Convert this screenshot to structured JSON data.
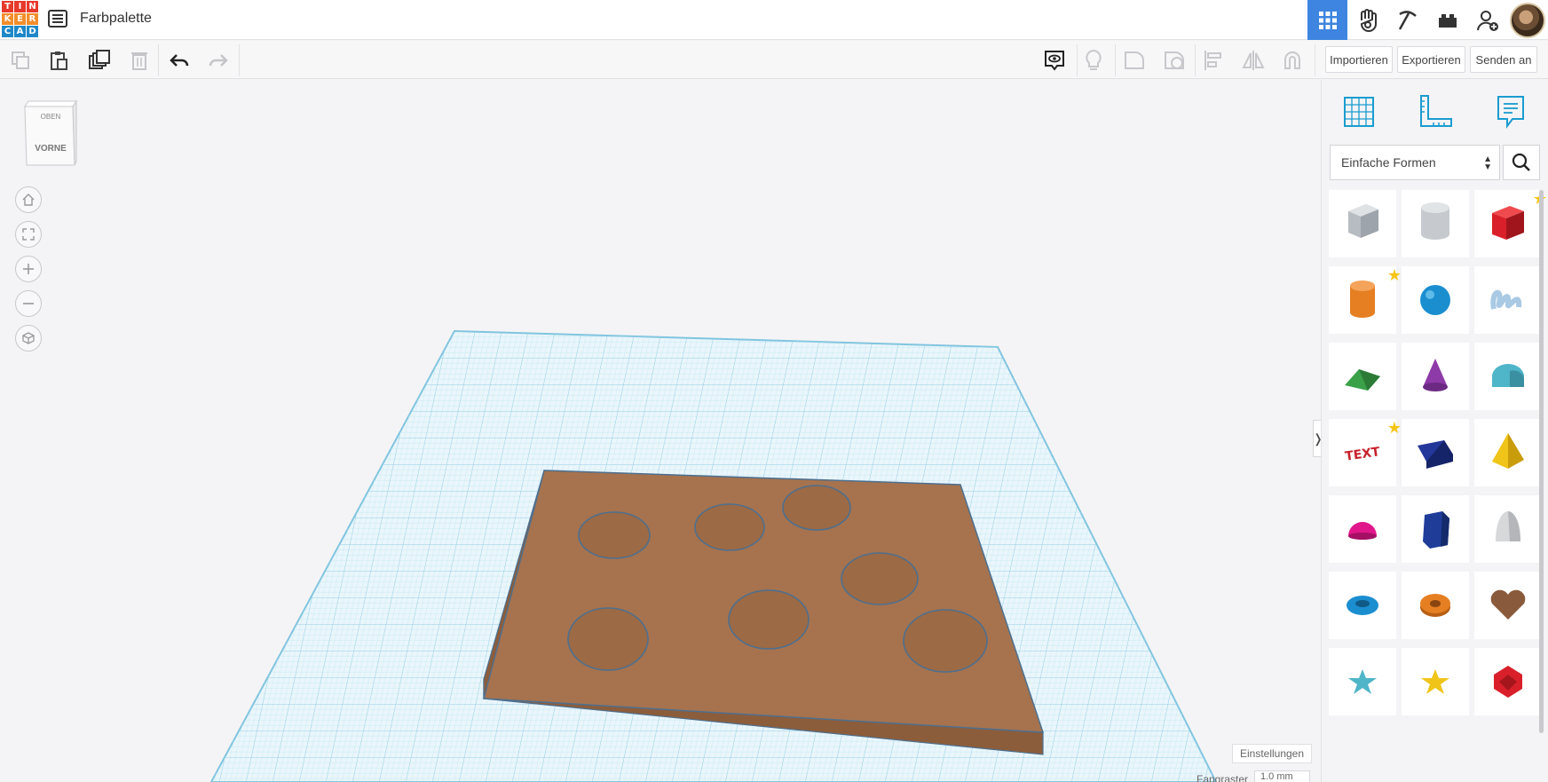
{
  "app": {
    "logo_letters": [
      "T",
      "I",
      "N",
      "K",
      "E",
      "R",
      "C",
      "A",
      "D"
    ],
    "logo_colors": [
      "#e7392b",
      "#e7392b",
      "#e7392b",
      "#f28e2b",
      "#f28e2b",
      "#f28e2b",
      "#1e88c8",
      "#1e88c8",
      "#1e88c8"
    ],
    "title": "Farbpalette"
  },
  "header": {
    "right_icons": [
      "grid-view-icon",
      "gallery-hand-icon",
      "pickaxe-icon",
      "lego-brick-icon",
      "add-user-icon",
      "user-avatar"
    ],
    "active_color": "#3d85e0"
  },
  "toolbar": {
    "edit_tools": [
      "copy-icon",
      "paste-icon",
      "duplicate-icon",
      "delete-icon",
      "undo-icon",
      "redo-icon"
    ],
    "view_tools": [
      "notes-visibility-icon",
      "lightbulb-icon",
      "shape-icon",
      "hole-icon",
      "align-icon",
      "mirror-icon",
      "magnet-icon"
    ],
    "import_label": "Importieren",
    "export_label": "Exportieren",
    "send_label": "Senden an"
  },
  "viewcube": {
    "top_label": "OBEN",
    "front_label": "VORNE"
  },
  "nav_controls": [
    "home-view-icon",
    "fit-view-icon",
    "zoom-in-icon",
    "zoom-out-icon",
    "perspective-icon"
  ],
  "panel": {
    "tabs": [
      "workplane-grid-icon",
      "ruler-icon",
      "notes-icon"
    ],
    "category": "Einfache Formen",
    "shapes": [
      {
        "name": "box-hole",
        "color": "#b7bcc2",
        "favorite": false
      },
      {
        "name": "cylinder-hole",
        "color": "#c6cacf",
        "favorite": false
      },
      {
        "name": "box",
        "color": "#d9202a",
        "favorite": true
      },
      {
        "name": "cylinder",
        "color": "#e57f22",
        "favorite": true
      },
      {
        "name": "sphere",
        "color": "#1b8ed0",
        "favorite": false
      },
      {
        "name": "scribble",
        "color": "#a9c9e4",
        "favorite": false
      },
      {
        "name": "roof",
        "color": "#3aa148",
        "favorite": false
      },
      {
        "name": "cone",
        "color": "#8e3aa8",
        "favorite": false
      },
      {
        "name": "round-roof",
        "color": "#4fb5c8",
        "favorite": false
      },
      {
        "name": "text",
        "color": "#c8202a",
        "favorite": true
      },
      {
        "name": "wedge",
        "color": "#23379a",
        "favorite": false
      },
      {
        "name": "pyramid",
        "color": "#f0c419",
        "favorite": false
      },
      {
        "name": "half-sphere",
        "color": "#e0168a",
        "favorite": false
      },
      {
        "name": "polygon",
        "color": "#1f3c99",
        "favorite": false
      },
      {
        "name": "paraboloid",
        "color": "#d6d8da",
        "favorite": false
      },
      {
        "name": "torus",
        "color": "#1b8ed0",
        "favorite": false
      },
      {
        "name": "tube",
        "color": "#e57f22",
        "favorite": false
      },
      {
        "name": "heart",
        "color": "#8a5a3c",
        "favorite": false
      },
      {
        "name": "star",
        "color": "#4fb5c8",
        "favorite": false
      },
      {
        "name": "star-gold",
        "color": "#f0c419",
        "favorite": false
      },
      {
        "name": "icosahedron",
        "color": "#d9202a",
        "favorite": false
      }
    ]
  },
  "footer": {
    "settings_label": "Einstellungen",
    "snap_label": "Fangraster",
    "snap_value": "1.0 mm"
  },
  "scene": {
    "object_color": "#a6734e",
    "grid_color": "#9fd8ec"
  }
}
